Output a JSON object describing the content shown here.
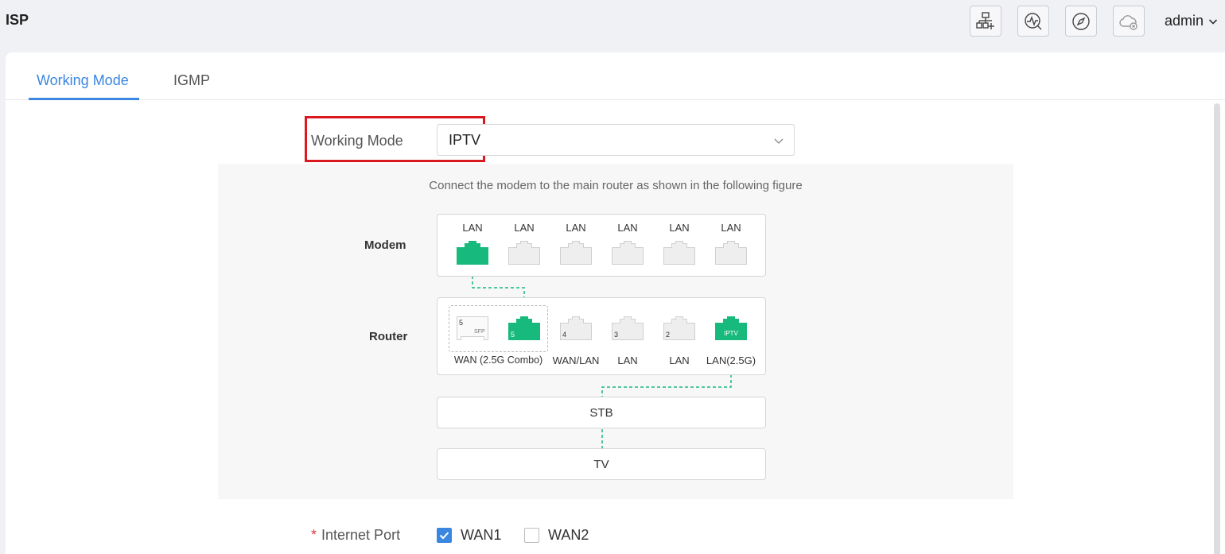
{
  "header": {
    "title": "ISP",
    "user": "admin",
    "tools": [
      {
        "icon": "network-topology-icon"
      },
      {
        "icon": "diagnostics-icon"
      },
      {
        "icon": "compass-icon"
      },
      {
        "icon": "cloud-disconnected-icon"
      }
    ]
  },
  "tabs": [
    {
      "label": "Working Mode",
      "active": true
    },
    {
      "label": "IGMP",
      "active": false
    }
  ],
  "working_mode": {
    "label": "Working Mode",
    "value": "IPTV"
  },
  "diagram": {
    "caption": "Connect the modem to the main router as shown in the following figure",
    "modem": {
      "label": "Modem",
      "ports": [
        "LAN",
        "LAN",
        "LAN",
        "LAN",
        "LAN",
        "LAN"
      ]
    },
    "router": {
      "label": "Router",
      "ports": [
        {
          "number": "5",
          "tag": "SFP"
        },
        {
          "number": "5",
          "tag": ""
        },
        {
          "number": "4",
          "tag": ""
        },
        {
          "number": "3",
          "tag": ""
        },
        {
          "number": "2",
          "tag": ""
        },
        {
          "number": "",
          "tag": "IPTV"
        }
      ],
      "port_labels": [
        "WAN (2.5G Combo)",
        "WAN/LAN",
        "LAN",
        "LAN",
        "LAN(2.5G)"
      ]
    },
    "stb": "STB",
    "tv": "TV"
  },
  "internet_port": {
    "label": "Internet Port",
    "required_mark": "*",
    "options": [
      {
        "label": "WAN1",
        "checked": true
      },
      {
        "label": "WAN2",
        "checked": false
      }
    ]
  },
  "colors": {
    "accent": "#3a86e0",
    "active_port": "#18b97c",
    "highlight": "#d9181f"
  }
}
